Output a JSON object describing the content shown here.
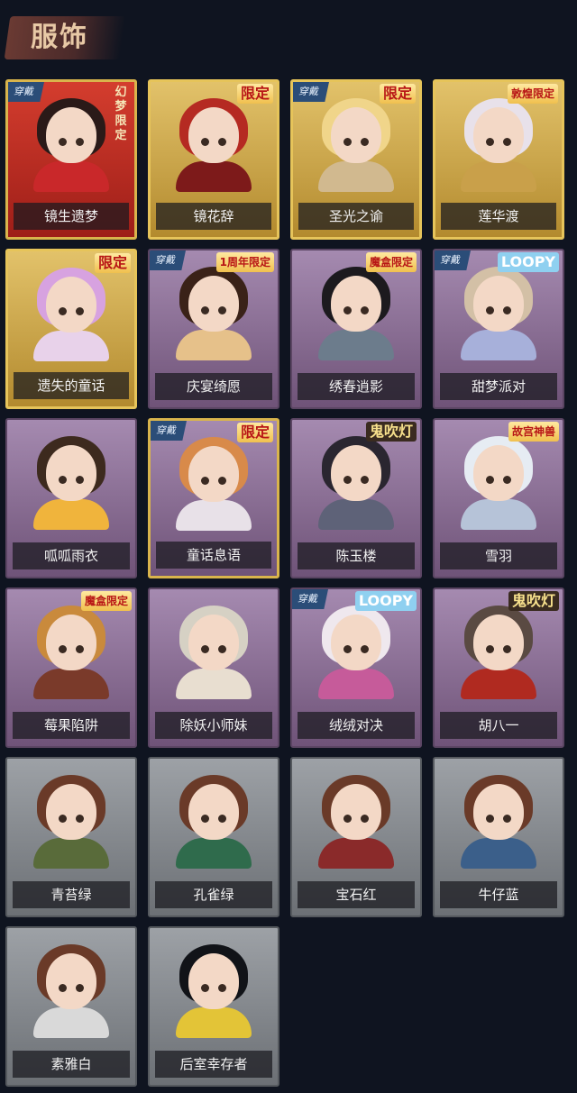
{
  "header": {
    "title": "服饰"
  },
  "labels": {
    "equipped": "穿戴"
  },
  "cards": [
    {
      "name": "镜生遗梦",
      "style": "red",
      "equipped": true,
      "badge": "幻梦限定",
      "badge_style": "vert",
      "hair": "#2a1a18",
      "body": "#c9282a"
    },
    {
      "name": "镜花辞",
      "style": "gold",
      "equipped": false,
      "badge": "限定",
      "badge_style": "",
      "hair": "#b52a22",
      "body": "#7d1a1a"
    },
    {
      "name": "圣光之谕",
      "style": "gold",
      "equipped": true,
      "badge": "限定",
      "badge_style": "",
      "hair": "#f0d58a",
      "body": "#d1b98f"
    },
    {
      "name": "莲华渡",
      "style": "gold",
      "equipped": false,
      "badge": "敦煌限定",
      "badge_style": "small",
      "hair": "#e8e1ea",
      "body": "#c9a04a"
    },
    {
      "name": "遗失的童话",
      "style": "gold",
      "equipped": false,
      "badge": "限定",
      "badge_style": "",
      "hair": "#d7a2e0",
      "body": "#e8d2ea"
    },
    {
      "name": "庆宴绮愿",
      "style": "purple",
      "equipped": true,
      "badge": "1周年限定",
      "badge_style": "small",
      "hair": "#3a2218",
      "body": "#e6c18a"
    },
    {
      "name": "绣春逍影",
      "style": "purple",
      "equipped": false,
      "badge": "魔盒限定",
      "badge_style": "small",
      "hair": "#1c1a1e",
      "body": "#6c7c8c"
    },
    {
      "name": "甜梦派对",
      "style": "purple",
      "equipped": true,
      "badge": "LOOPY",
      "badge_style": "blue",
      "hair": "#d3c0a6",
      "body": "#a7b0da"
    },
    {
      "name": "呱呱雨衣",
      "style": "purple",
      "equipped": false,
      "badge": "",
      "badge_style": "",
      "hair": "#3d2a1e",
      "body": "#f0b43c"
    },
    {
      "name": "童话息语",
      "style": "purple",
      "equipped": true,
      "badge": "限定",
      "badge_style": "",
      "hair": "#d88a4a",
      "body": "#e8e1e8"
    },
    {
      "name": "陈玉楼",
      "style": "purple",
      "equipped": false,
      "badge": "鬼吹灯",
      "badge_style": "dark",
      "hair": "#2a2630",
      "body": "#5e6278"
    },
    {
      "name": "雪羽",
      "style": "purple",
      "equipped": false,
      "badge": "故宫神兽",
      "badge_style": "small",
      "hair": "#e6ecf3",
      "body": "#b6c3d8"
    },
    {
      "name": "莓果陷阱",
      "style": "purple",
      "equipped": false,
      "badge": "魔盒限定",
      "badge_style": "small",
      "hair": "#c98a3c",
      "body": "#7a3a2a"
    },
    {
      "name": "除妖小师妹",
      "style": "purple",
      "equipped": false,
      "badge": "",
      "badge_style": "",
      "hair": "#d6d1c4",
      "body": "#e8ded0"
    },
    {
      "name": "绒绒对决",
      "style": "purple",
      "equipped": true,
      "badge": "LOOPY",
      "badge_style": "blue",
      "hair": "#efe8ee",
      "body": "#c65b9a"
    },
    {
      "name": "胡八一",
      "style": "purple",
      "equipped": false,
      "badge": "鬼吹灯",
      "badge_style": "dark",
      "hair": "#5a4a42",
      "body": "#b02a20"
    },
    {
      "name": "青苔绿",
      "style": "gray",
      "equipped": false,
      "badge": "",
      "badge_style": "",
      "hair": "#6a3a28",
      "body": "#596b3a"
    },
    {
      "name": "孔雀绿",
      "style": "gray",
      "equipped": false,
      "badge": "",
      "badge_style": "",
      "hair": "#6a3a28",
      "body": "#2f6b4c"
    },
    {
      "name": "宝石红",
      "style": "gray",
      "equipped": false,
      "badge": "",
      "badge_style": "",
      "hair": "#6a3a28",
      "body": "#8a2a2a"
    },
    {
      "name": "牛仔蓝",
      "style": "gray",
      "equipped": false,
      "badge": "",
      "badge_style": "",
      "hair": "#6a3a28",
      "body": "#3b5f8a"
    },
    {
      "name": "素雅白",
      "style": "gray",
      "equipped": false,
      "badge": "",
      "badge_style": "",
      "hair": "#6a3a28",
      "body": "#d9d9d9"
    },
    {
      "name": "后室幸存者",
      "style": "gray",
      "equipped": false,
      "badge": "",
      "badge_style": "",
      "hair": "#111318",
      "body": "#e3c437"
    }
  ]
}
